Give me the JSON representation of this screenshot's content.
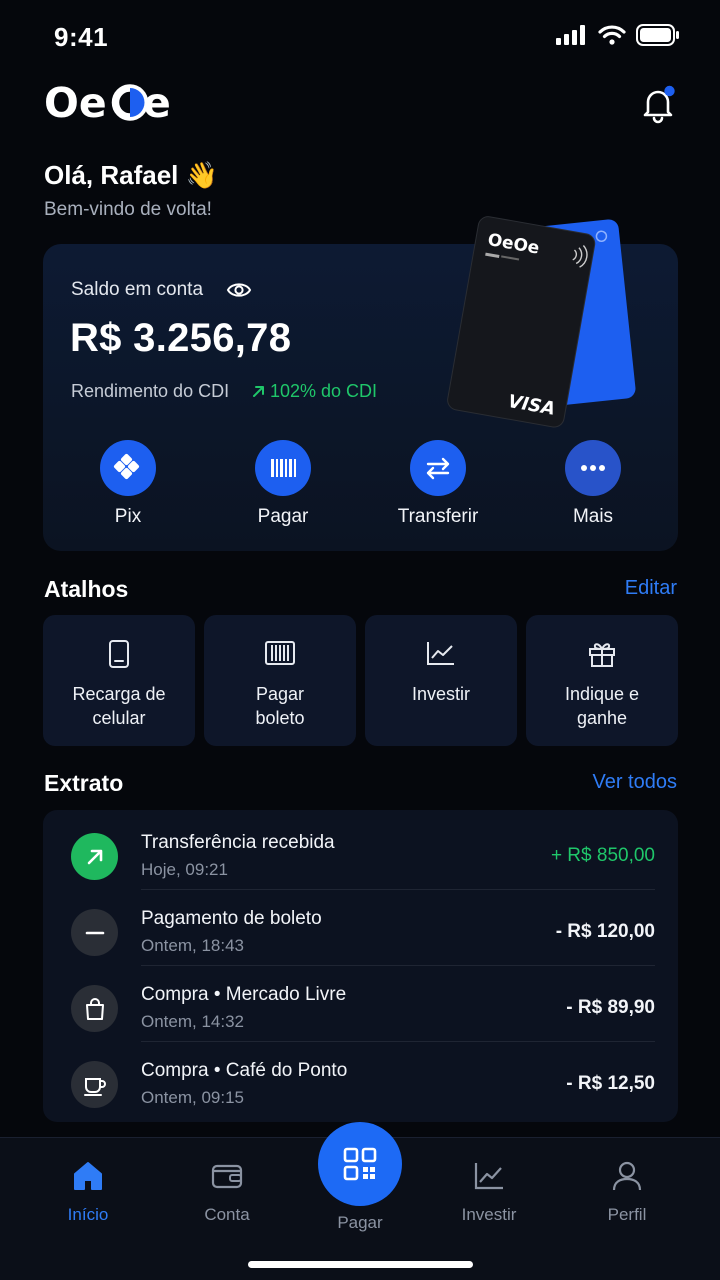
{
  "status_bar": {
    "time": "9:41"
  },
  "brand": {
    "logo_text": "OeOe",
    "accent": "#1d5ff0"
  },
  "header": {
    "notification_icon": "bell-icon"
  },
  "greeting": {
    "title": "Olá, Rafael 👋",
    "subtitle": "Bem-vindo de volta!"
  },
  "balance": {
    "label": "Saldo em conta",
    "value": "R$ 3.256,78",
    "cdi_label": "Rendimento do CDI",
    "cdi_value": "102% do CDI",
    "card_brand": "VISA"
  },
  "actions": [
    {
      "label": "Pix",
      "icon": "pix-icon"
    },
    {
      "label": "Pagar",
      "icon": "barcode-icon"
    },
    {
      "label": "Transferir",
      "icon": "transfer-icon"
    },
    {
      "label": "Mais",
      "icon": "more-icon"
    }
  ],
  "shortcuts": {
    "title": "Atalhos",
    "edit_label": "Editar",
    "items": [
      {
        "label": "Recarga de\ncelular",
        "icon": "phone-icon"
      },
      {
        "label": "Pagar\nboleto",
        "icon": "barcode-icon"
      },
      {
        "label": "Investir",
        "icon": "chart-icon"
      },
      {
        "label": "Indique e\nganhe",
        "icon": "gift-icon"
      }
    ]
  },
  "statement": {
    "title": "Extrato",
    "see_all_label": "Ver todos",
    "items": [
      {
        "title": "Transferência recebida",
        "date": "Hoje, 09:21",
        "amount": "+ R$ 850,00",
        "icon": "arrow-up-right-icon",
        "positive": true
      },
      {
        "title": "Pagamento de boleto",
        "date": "Ontem, 18:43",
        "amount": "- R$ 120,00",
        "icon": "minus-icon",
        "positive": false
      },
      {
        "title": "Compra  •  Mercado Livre",
        "date": "Ontem, 14:32",
        "amount": "- R$ 89,90",
        "icon": "shopping-bag-icon",
        "positive": false
      },
      {
        "title": "Compra  •  Café do Ponto",
        "date": "Ontem, 09:15",
        "amount": "- R$ 12,50",
        "icon": "coffee-icon",
        "positive": false
      }
    ]
  },
  "tabbar": {
    "items": [
      {
        "label": "Início",
        "icon": "home-icon",
        "active": true
      },
      {
        "label": "Conta",
        "icon": "wallet-icon",
        "active": false
      },
      {
        "label": "Pagar",
        "icon": "qr-code-icon",
        "active": false
      },
      {
        "label": "Investir",
        "icon": "chart-icon",
        "active": false
      },
      {
        "label": "Perfil",
        "icon": "user-icon",
        "active": false
      }
    ]
  },
  "colors": {
    "positive": "#1fc76a",
    "link": "#2f7cf6",
    "background": "#05070c"
  }
}
